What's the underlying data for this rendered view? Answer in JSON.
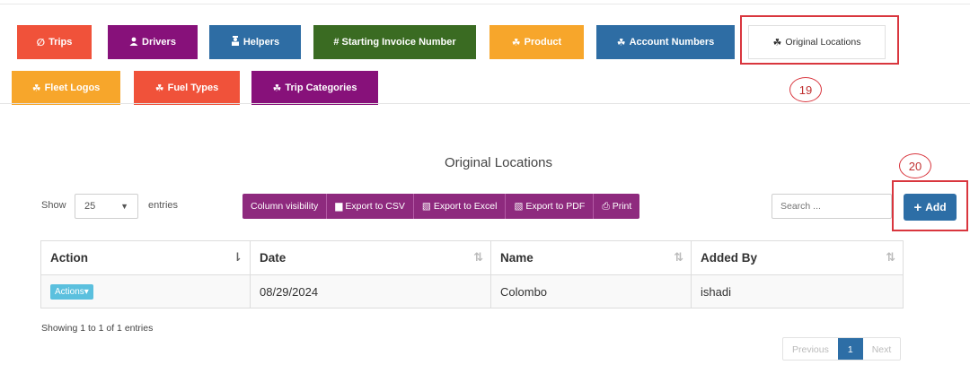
{
  "colors": {
    "trips": "#f0523a",
    "drivers": "#87117a",
    "helpers": "#2e6da4",
    "starting_invoice": "#3a6b22",
    "product": "#f7a62b",
    "account_numbers": "#2e6da4",
    "fleet_logos": "#f7a62b",
    "fuel_types": "#f0523a",
    "trip_categories": "#87117a",
    "annotation": "#d9363e",
    "export_buttons": "#8e2a7e",
    "add_button": "#2d6ea6",
    "actions_button": "#5bc0de"
  },
  "tabs": {
    "trips": {
      "label": "Trips",
      "icon": "slash-circle-icon"
    },
    "drivers": {
      "label": "Drivers",
      "icon": "user-icon"
    },
    "helpers": {
      "label": "Helpers",
      "icon": "helper-icon"
    },
    "starting_invoice": {
      "label": "# Starting Invoice Number"
    },
    "product": {
      "label": "Product",
      "icon": "cubes-icon"
    },
    "account_numbers": {
      "label": "Account Numbers",
      "icon": "cubes-icon"
    },
    "original_locations": {
      "label": "Original Locations",
      "icon": "cubes-icon"
    },
    "fleet_logos": {
      "label": "Fleet Logos",
      "icon": "cubes-icon"
    },
    "fuel_types": {
      "label": "Fuel Types",
      "icon": "cubes-icon"
    },
    "trip_categories": {
      "label": "Trip Categories",
      "icon": "cubes-icon"
    }
  },
  "annotations": {
    "tab_marker": "19",
    "add_marker": "20"
  },
  "page": {
    "title": "Original Locations"
  },
  "controls": {
    "show_label": "Show",
    "entries_value": "25",
    "entries_label": "entries",
    "export_buttons": [
      "Column visibility",
      "Export to CSV",
      "Export to Excel",
      "Export to PDF",
      "Print"
    ],
    "search_placeholder": "Search ...",
    "add_label": "Add"
  },
  "table": {
    "headers": [
      "Action",
      "Date",
      "Name",
      "Added By"
    ],
    "rows": [
      {
        "action": "Actions",
        "date": "08/29/2024",
        "name": "Colombo",
        "added_by": "ishadi"
      }
    ]
  },
  "footer": {
    "info": "Showing 1 to 1 of 1 entries",
    "pagination": {
      "previous": "Previous",
      "current": "1",
      "next": "Next"
    }
  }
}
